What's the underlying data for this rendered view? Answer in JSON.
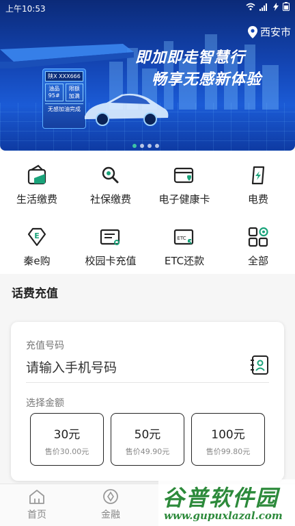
{
  "status_bar": {
    "time": "上午10:53"
  },
  "banner": {
    "location": "西安市",
    "slogan_line1": "即加即走智慧行",
    "slogan_line2": "畅享无感新体验",
    "sign": {
      "plate": "陕X XXX666",
      "fuel": "油品 95#",
      "amount": "限额 加满",
      "footer": "无感加油完成"
    },
    "carousel_count": 4,
    "active_index": 0
  },
  "quick_services": [
    {
      "label": "生活缴费",
      "icon": "wallet-icon"
    },
    {
      "label": "社保缴费",
      "icon": "search-magnifier-icon"
    },
    {
      "label": "电子健康卡",
      "icon": "health-card-icon"
    },
    {
      "label": "电费",
      "icon": "electric-icon"
    },
    {
      "label": "秦e购",
      "icon": "shopping-diamond-icon"
    },
    {
      "label": "校园卡充值",
      "icon": "campus-card-icon"
    },
    {
      "label": "ETC还款",
      "icon": "etc-card-icon"
    },
    {
      "label": "全部",
      "icon": "grid-all-icon"
    }
  ],
  "recharge": {
    "title": "话费充值",
    "number_label": "充值号码",
    "number_placeholder": "请输入手机号码",
    "amount_label": "选择金额",
    "amounts": [
      {
        "value": "30元",
        "price": "售价30.00元"
      },
      {
        "value": "50元",
        "price": "售价49.90元"
      },
      {
        "value": "100元",
        "price": "售价99.80元"
      }
    ]
  },
  "bottom_nav": [
    {
      "label": "首页",
      "icon": "home-icon"
    },
    {
      "label": "金融",
      "icon": "finance-icon"
    }
  ],
  "watermark": {
    "big": "谷普软件园",
    "small": "www.gupuxlazal.com"
  },
  "colors": {
    "accent": "#1aa37a",
    "banner_blue": "#1447b7"
  }
}
